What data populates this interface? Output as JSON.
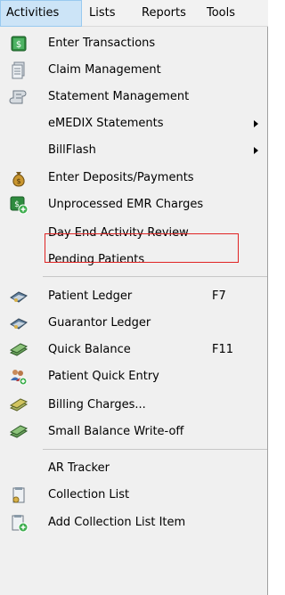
{
  "menubar": {
    "items": [
      {
        "label": "Activities",
        "active": true
      },
      {
        "label": "Lists"
      },
      {
        "label": "Reports"
      },
      {
        "label": "Tools"
      }
    ]
  },
  "menu": {
    "items": [
      {
        "label": "Enter Transactions",
        "icon": "dollar-sheet-icon"
      },
      {
        "label": "Claim Management",
        "icon": "document-stack-icon"
      },
      {
        "label": "Statement Management",
        "icon": "scroll-icon"
      },
      {
        "label": "eMEDIX Statements",
        "submenu": true
      },
      {
        "label": "BillFlash",
        "submenu": true
      },
      {
        "label": "Enter Deposits/Payments",
        "icon": "money-bag-icon"
      },
      {
        "label": "Unprocessed EMR Charges",
        "icon": "dollar-add-icon"
      },
      {
        "label": "Day End Activity Review",
        "highlighted": true
      },
      {
        "label": "Pending Patients"
      },
      {
        "label": "Patient Ledger",
        "accelerator": "F7",
        "icon": "ledger-icon"
      },
      {
        "label": "Guarantor Ledger",
        "icon": "ledger-icon"
      },
      {
        "label": "Quick Balance",
        "accelerator": "F11",
        "icon": "money-stack-icon"
      },
      {
        "label": "Patient Quick Entry",
        "icon": "people-add-icon"
      },
      {
        "label": "Billing Charges...",
        "icon": "money-stack-icon"
      },
      {
        "label": "Small Balance Write-off",
        "icon": "money-stack-icon"
      },
      {
        "label": "AR Tracker"
      },
      {
        "label": "Collection List",
        "icon": "collection-list-icon"
      },
      {
        "label": "Add Collection List Item",
        "icon": "collection-add-icon"
      }
    ]
  },
  "colors": {
    "highlight_box": "#e02424",
    "active_menu_bg": "#cce4f7",
    "icon_green": "#2e8b3e"
  }
}
